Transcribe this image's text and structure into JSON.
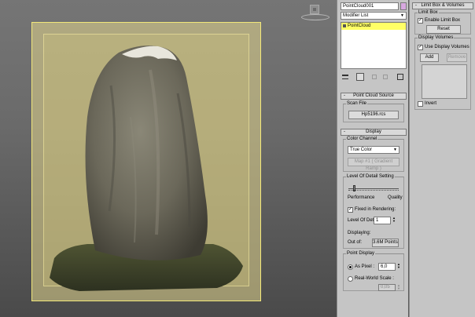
{
  "modifier_panel": {
    "object_name": "PointCloud001",
    "object_color": "#d8a8e0",
    "modifier_list_label": "Modifier List",
    "stack_item": "PointCloud",
    "stack_bg": "#ffff66"
  },
  "source_rollout": {
    "title": "Point Cloud Source",
    "group_title": "Scan File",
    "file_button": "Hp5196.rcs"
  },
  "display_rollout": {
    "title": "Display",
    "color_channel_group": "Color Channel",
    "color_channel_value": "True Color",
    "map_button": "Map #1 ( Gradient Ramp )",
    "lod_group": "Level Of Detail Setting",
    "performance_label": "Performance",
    "quality_label": "Quality",
    "fixed_rendering_label": "Fixed in Rendering:",
    "lod_label": "Level Of Detail:",
    "lod_value": "1",
    "displaying_label": "Displaying:",
    "out_of_label": "Out of:",
    "points_total": "3.6M Points",
    "point_display_group": "Point Display",
    "as_pixel_label": "As Pixel :",
    "as_pixel_value": "6,0",
    "real_world_label": "Real-World Scale :",
    "real_world_value": "0,05"
  },
  "limit_rollout": {
    "title": "Limit Box & Volumes",
    "limit_group": "Limit Box",
    "enable_limit_label": "Enable Limit Box",
    "reset_button": "Reset",
    "display_group": "Display Volumes",
    "use_display_label": "Use Display Volumes",
    "add_button": "Add",
    "remove_button": "Remove",
    "invert_label": "Invert"
  },
  "icons": [
    "pin-stack-icon",
    "show-end-result-icon",
    "make-unique-icon",
    "remove-modifier-icon",
    "configure-sets-icon"
  ]
}
